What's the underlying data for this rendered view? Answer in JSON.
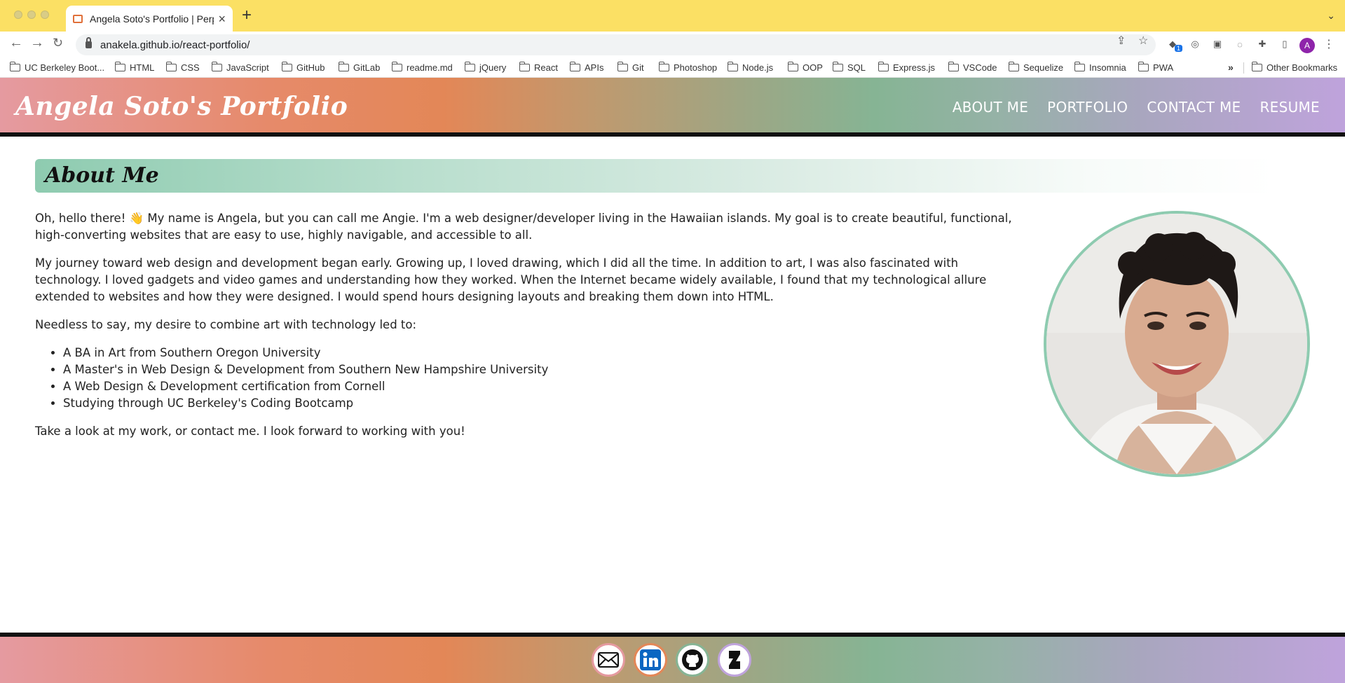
{
  "browser": {
    "tab_title": "Angela Soto's Portfolio | Perpe",
    "url": "anakela.github.io/react-portfolio/",
    "profile_initial": "A",
    "extension_badge": "1",
    "bookmarks": [
      "UC Berkeley Boot...",
      "HTML",
      "CSS",
      "JavaScript",
      "GitHub",
      "GitLab",
      "readme.md",
      "jQuery",
      "React",
      "APIs",
      "Git",
      "Photoshop",
      "Node.js",
      "OOP",
      "SQL",
      "Express.js",
      "VSCode",
      "Sequelize",
      "Insomnia",
      "PWA"
    ],
    "other_bookmarks": "Other Bookmarks"
  },
  "header": {
    "title": "Angela Soto's Portfolio",
    "nav": [
      "ABOUT ME",
      "PORTFOLIO",
      "CONTACT ME",
      "RESUME"
    ]
  },
  "about": {
    "heading": "About Me",
    "p1": "Oh, hello there! 👋 My name is Angela, but you can call me Angie. I'm a web designer/developer living in the Hawaiian islands. My goal is to create beautiful, functional, high-converting websites that are easy to use, highly navigable, and accessible to all.",
    "p2": "My journey toward web design and development began early. Growing up, I loved drawing, which I did all the time. In addition to art, I was also fascinated with technology. I loved gadgets and video games and understanding how they worked. When the Internet became widely available, I found that my technological allure extended to websites and how they were designed. I would spend hours designing layouts and breaking them down into HTML.",
    "p3": "Needless to say, my desire to combine art with technology led to:",
    "list": [
      "A BA in Art from Southern Oregon University",
      "A Master's in Web Design & Development from Southern New Hampshire University",
      "A Web Design & Development certification from Cornell",
      "Studying through UC Berkeley's Coding Bootcamp"
    ],
    "p4": "Take a look at my work, or contact me. I look forward to working with you!"
  },
  "footer": {
    "links": [
      {
        "icon": "email-icon",
        "ring": "#e59aa0"
      },
      {
        "icon": "linkedin-icon",
        "ring": "#e38757"
      },
      {
        "icon": "github-icon",
        "ring": "#86b494"
      },
      {
        "icon": "deviantart-icon",
        "ring": "#bfa3dc"
      }
    ]
  },
  "colors": {
    "accent_green": "#8ecbb0",
    "browser_tabbar": "#fbe064",
    "linkedin_blue": "#0a66c2"
  }
}
